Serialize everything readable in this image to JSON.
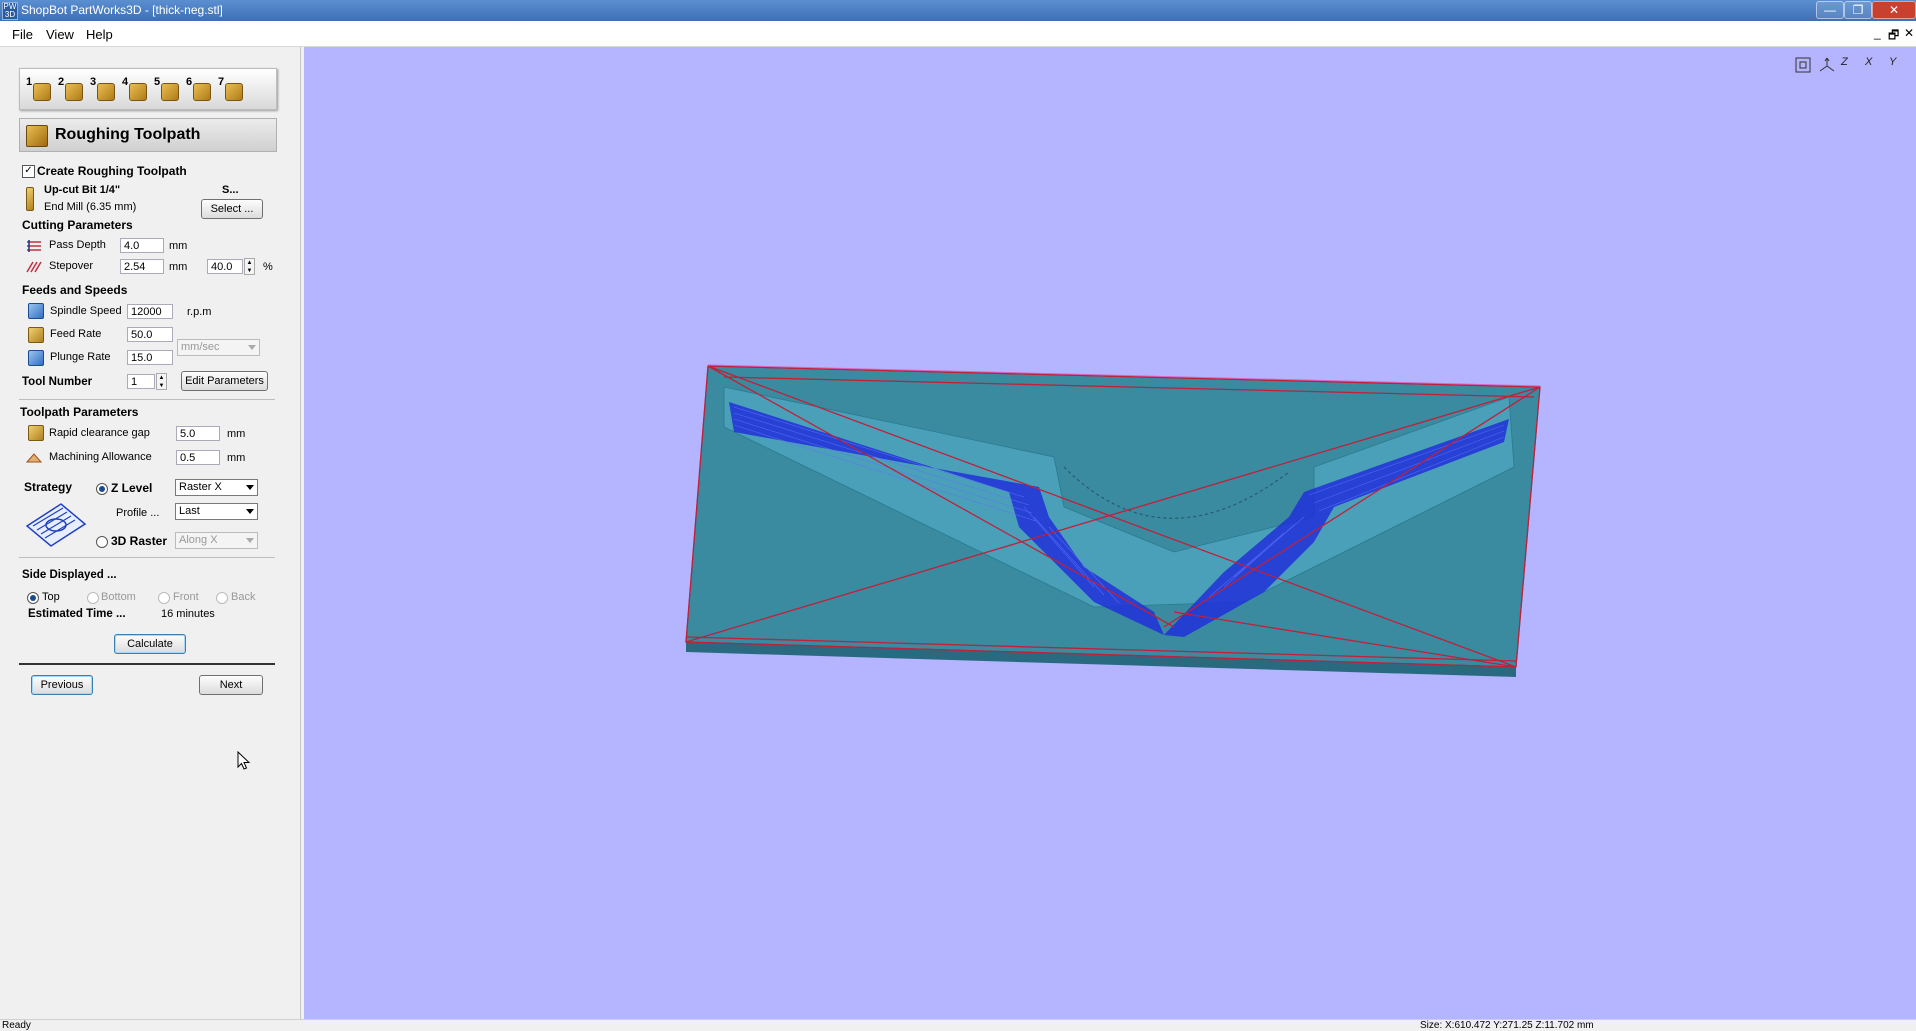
{
  "window": {
    "title": "ShopBot PartWorks3D - [thick-neg.stl]",
    "icon_text": "PW 3D",
    "minimize": "—",
    "restore": "❐",
    "close": "✕"
  },
  "menu": {
    "file": "File",
    "view": "View",
    "help": "Help",
    "mdi_min": "_",
    "mdi_restore": "🗗",
    "mdi_close": "✕"
  },
  "steps": [
    "1",
    "2",
    "3",
    "4",
    "5",
    "6",
    "7"
  ],
  "panel": {
    "header": "Roughing Toolpath",
    "create_label": "Create Roughing Toolpath",
    "create_checked": true,
    "tool_name": "Up-cut Bit 1/4\"",
    "tool_desc": "End Mill (6.35 mm)",
    "tool_short": "S...",
    "select_button": "Select ...",
    "cutting": {
      "heading": "Cutting Parameters",
      "pass_depth_label": "Pass Depth",
      "pass_depth_value": "4.0",
      "pass_depth_unit": "mm",
      "stepover_label": "Stepover",
      "stepover_value": "2.54",
      "stepover_unit": "mm",
      "stepover_percent": "40.0",
      "percent_sign": "%"
    },
    "feeds": {
      "heading": "Feeds and Speeds",
      "spindle_label": "Spindle Speed",
      "spindle_value": "12000",
      "spindle_unit": "r.p.m",
      "feed_label": "Feed Rate",
      "feed_value": "50.0",
      "plunge_label": "Plunge Rate",
      "plunge_value": "15.0",
      "rate_unit": "mm/sec",
      "tool_number_label": "Tool Number",
      "tool_number_value": "1",
      "edit_button": "Edit Parameters"
    },
    "toolpath": {
      "heading": "Toolpath Parameters",
      "rapid_label": "Rapid clearance gap",
      "rapid_value": "5.0",
      "rapid_unit": "mm",
      "allowance_label": "Machining Allowance",
      "allowance_value": "0.5",
      "allowance_unit": "mm"
    },
    "strategy": {
      "label": "Strategy",
      "zlevel_label": "Z Level",
      "zlevel_option": "Raster X",
      "profile_label": "Profile ...",
      "profile_option": "Last",
      "raster_label": "3D Raster",
      "raster_option": "Along X"
    },
    "side": {
      "heading": "Side Displayed ...",
      "top": "Top",
      "bottom": "Bottom",
      "front": "Front",
      "back": "Back",
      "selected": "Top"
    },
    "estimated_label": "Estimated Time ...",
    "estimated_value": "16 minutes",
    "calculate_button": "Calculate",
    "previous_button": "Previous",
    "next_button": "Next"
  },
  "view_toolbar": [
    "Z",
    "X",
    "Y"
  ],
  "status": {
    "left": "Ready",
    "right": "Size: X:610.472 Y:271.25 Z:11.702 mm"
  },
  "colors": {
    "viewport_bg": "#b4b4ff",
    "model_teal": "#3a8aa0",
    "toolpath_blue": "#1f2fd8",
    "rapid_red": "#c0203a"
  }
}
